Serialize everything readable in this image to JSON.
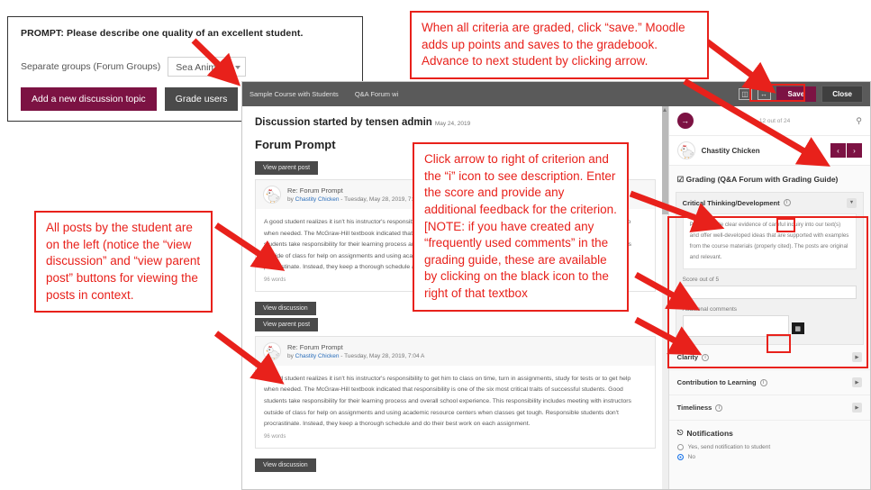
{
  "forum_panel": {
    "prompt": "PROMPT: Please describe one quality of an excellent student.",
    "groups_label": "Separate groups (Forum Groups)",
    "group_selected": "Sea Animals",
    "add_topic_button": "Add a new discussion topic",
    "grade_users_button": "Grade users"
  },
  "moodle": {
    "topbar": {
      "breadcrumb_course": "Sample Course with Students",
      "breadcrumb_activity": "Q&A Forum wi",
      "save_label": "Save",
      "close_label": "Close"
    },
    "discussion": {
      "started_by": "Discussion started by tensen admin",
      "started_date": "May 24, 2019",
      "forum_title": "Forum Prompt",
      "posts": [
        {
          "context_buttons": [
            "View parent post"
          ],
          "subject": "Re: Forum Prompt",
          "byline": "by Chastity Chicken - Tuesday, May 28, 2019, 7:04 A",
          "author": "Chastity Chicken",
          "body": "A good student realizes it isn't his instructor's responsibility to get him to class on time, turn in assignments, study for tests or to get help when needed. The McGraw-Hill textbook indicated that responsibility is one of the six most critical traits of successful students. Good students take responsibility for their learning process and overall school experience. This responsibility includes meeting with instructors outside of class for help on assignments and using academic resource centers when classes get tough. Responsible students don't procrastinate. Instead, they keep a thorough schedule and do their best work on each assignment.",
          "word_count": "96 words"
        },
        {
          "context_buttons": [
            "View discussion",
            "View parent post"
          ],
          "subject": "Re: Forum Prompt",
          "byline": "by Chastity Chicken - Tuesday, May 28, 2019, 7:04 A",
          "author": "Chastity Chicken",
          "body": "A good student realizes it isn't his instructor's responsibility to get him to class on time, turn in assignments, study for tests or to get help when needed. The McGraw-Hill textbook indicated that responsibility is one of the six most critical traits of successful students. Good students take responsibility for their learning process and overall school experience. This responsibility includes meeting with instructors outside of class for help on assignments and using academic resource centers when classes get tough. Responsible students don't procrastinate. Instead, they keep a thorough schedule and do their best work on each assignment.",
          "word_count": "96 words"
        }
      ],
      "trailing_button": "View discussion"
    },
    "grading": {
      "count_text": "12 out of 24",
      "student_name": "Chastity Chicken",
      "prev_arrow": "‹",
      "next_arrow": "›",
      "panel_title": "☑ Grading (Q&A Forum with Grading Guide)",
      "active_criterion": {
        "name": "Critical Thinking/Development",
        "info_icon": "ⓘ",
        "description": "Posts provide clear evidence of careful inquiry into our text(s) and offer well-developed ideas that are supported with examples from the course materials (properly cited). The posts are original and relevant.",
        "score_label": "Score out of 5",
        "score_value": "",
        "comments_label": "Additional comments",
        "comments_value": ""
      },
      "other_criteria": [
        {
          "name": "Clarity"
        },
        {
          "name": "Contribution to Learning"
        },
        {
          "name": "Timeliness"
        }
      ],
      "notifications": {
        "title": "Notifications",
        "options": [
          {
            "label": "Yes, send notification to student",
            "selected": false
          },
          {
            "label": "No",
            "selected": true
          }
        ]
      }
    }
  },
  "callouts": {
    "save": "When all criteria are graded, click “save.” Moodle adds up points and saves to the gradebook. Advance to next student by clicking arrow.",
    "criterion": "Click arrow to right of criterion and the “i” icon to see description. Enter the score and provide any additional feedback for the criterion. [NOTE: if you have created any “frequently used comments” in the grading guide, these are available by clicking on the black icon to the right of that textbox",
    "posts": "All posts by the student are on the left (notice the “view discussion” and “view parent post” buttons for viewing the posts in context."
  },
  "colors": {
    "maroon": "#7c1243",
    "annotation_red": "#e8211b",
    "dark_gray": "#4a4a4a"
  }
}
